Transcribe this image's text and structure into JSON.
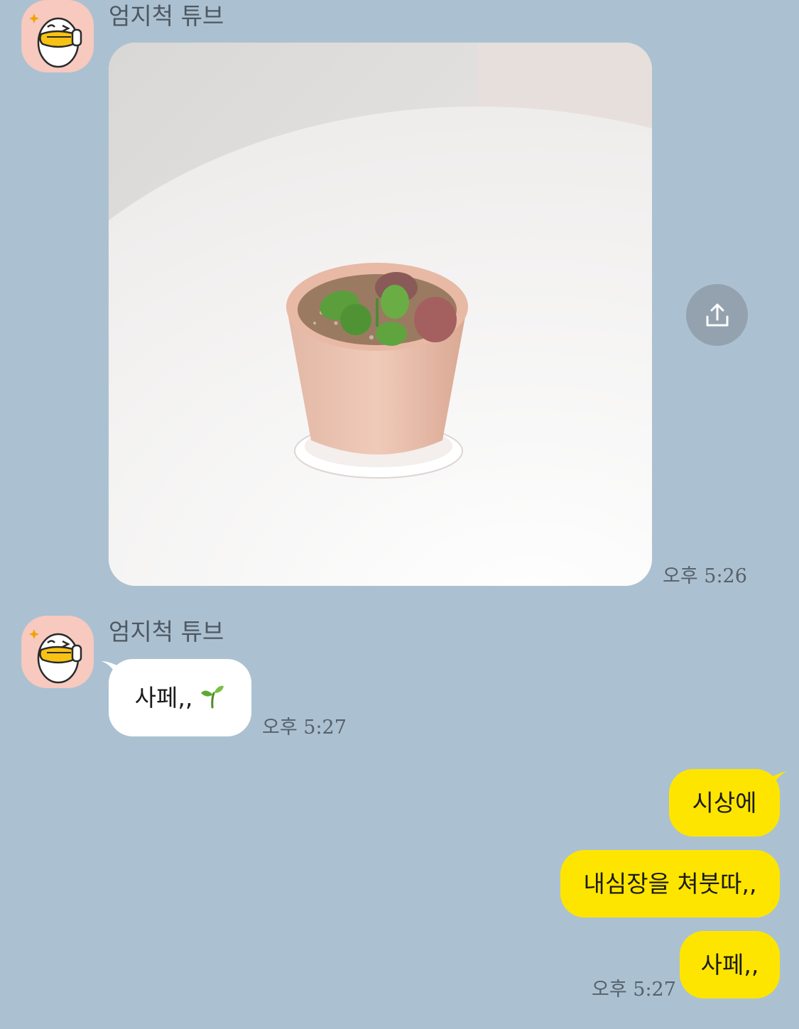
{
  "chat": {
    "messages": [
      {
        "sender": "엄지척 튜브",
        "type": "image",
        "time": "오후 5:26"
      },
      {
        "sender": "엄지척 튜브",
        "type": "text",
        "text": "사페,,",
        "emoji": "🌱",
        "time": "오후 5:27"
      },
      {
        "sender": "me",
        "type": "text-group",
        "texts": [
          "시상에",
          "내심장을 쳐붓따,,",
          "사페,,"
        ],
        "time": "오후 5:27"
      }
    ]
  },
  "icons": {
    "avatar": "tube-character-thumbs-up-icon",
    "share": "share-icon",
    "emoji": "seedling-icon"
  },
  "colors": {
    "background": "#abc1d1",
    "incoming_bubble": "#ffffff",
    "outgoing_bubble": "#fee500",
    "avatar_bg": "#f7c9bf",
    "share_button": "#93a2ae"
  }
}
